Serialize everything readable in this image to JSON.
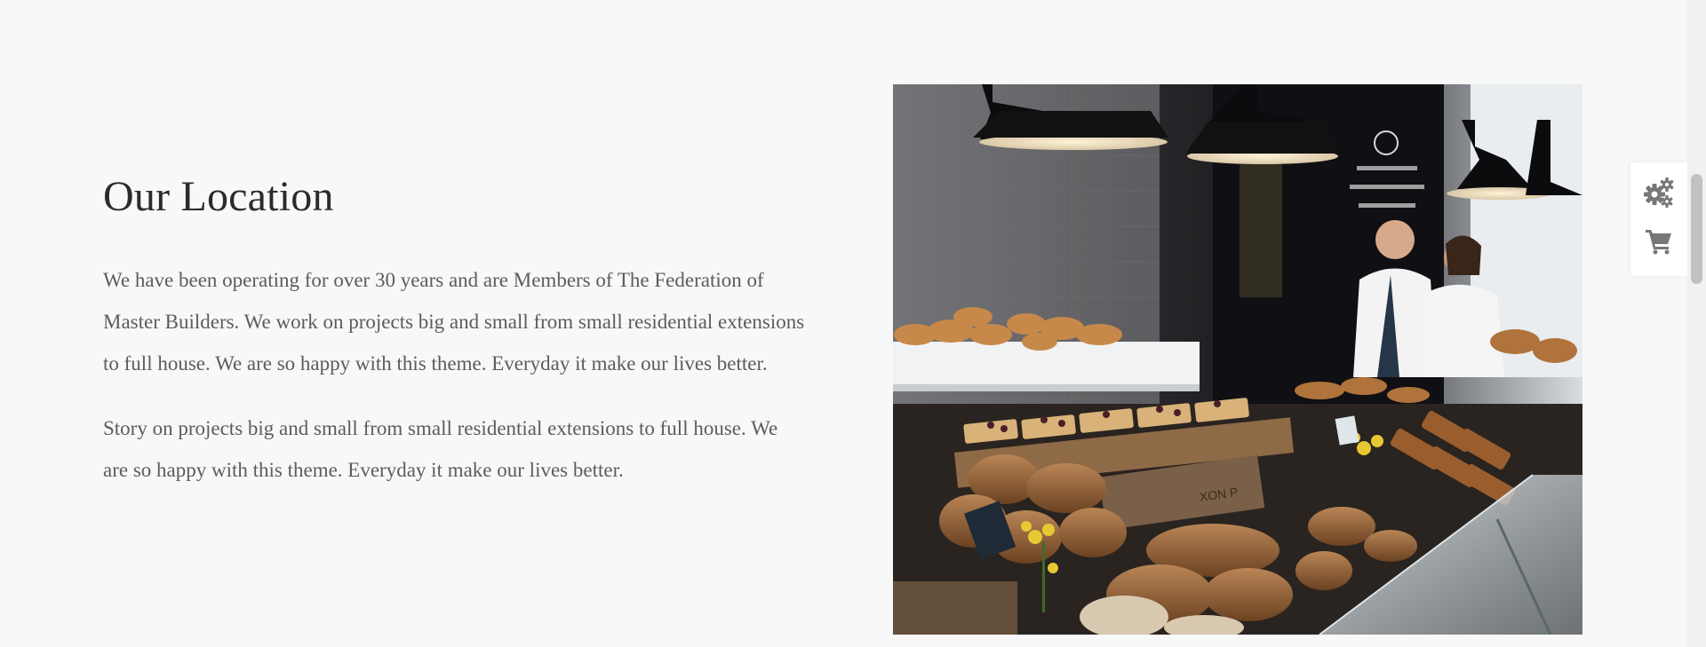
{
  "section": {
    "title": "Our Location",
    "paragraphs": [
      "We have been operating for over 30 years and are Members of The Federation of Master Builders. We work on projects big and small from small residential extensions to full house. We are so happy with this theme. Everyday it make our lives better.",
      "Story on projects big and small from small residential extensions to full house. We are so happy with this theme. Everyday it make our lives better."
    ]
  },
  "photo": {
    "subject": "bakery counter with bread and pastries",
    "sign_text": [
      "XON P"
    ]
  },
  "side_widget": {
    "icons": [
      "gears-icon",
      "cart-icon"
    ]
  },
  "colors": {
    "background": "#f8f8f8",
    "heading": "#2b2b2b",
    "body_text": "#5c5c5c",
    "icon": "#777777"
  }
}
